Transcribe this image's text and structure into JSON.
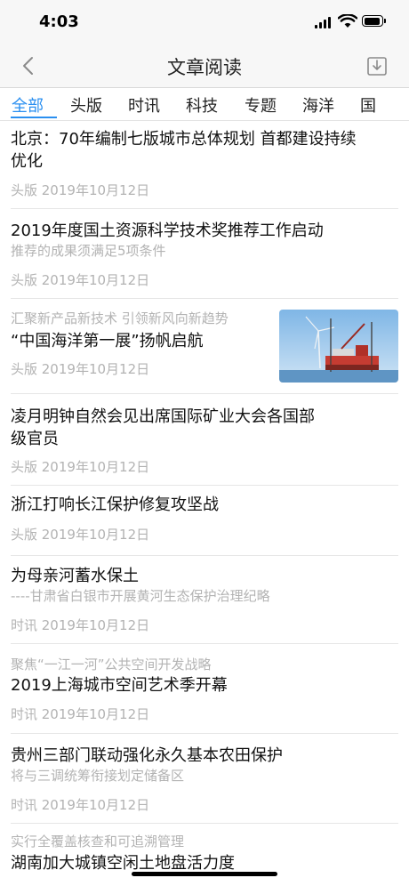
{
  "status": {
    "time": "4:03"
  },
  "nav": {
    "title": "文章阅读"
  },
  "tabs": [
    {
      "label": "全部"
    },
    {
      "label": "头版"
    },
    {
      "label": "时讯"
    },
    {
      "label": "科技"
    },
    {
      "label": "专题"
    },
    {
      "label": "海洋"
    },
    {
      "label": "国"
    }
  ],
  "articles": [
    {
      "title_line1": "北京：70年编制七版城市总体规划 首都建设持续",
      "title_line2": "优化",
      "meta": "头版 2019年10月12日"
    },
    {
      "title_line1": "2019年度国土资源科学技术奖推荐工作启动",
      "subtitle": "推荐的成果须满足5项条件",
      "meta": "头版 2019年10月12日"
    },
    {
      "pretitle": "汇聚新产品新技术 引领新风向新趋势",
      "title_line1": "“中国海洋第一展”扬帆启航",
      "meta": "头版 2019年10月12日",
      "image": "offshore-wind-platform"
    },
    {
      "title_line1": "凌月明钟自然会见出席国际矿业大会各国部",
      "title_line2": "级官员",
      "meta": "头版 2019年10月12日"
    },
    {
      "title_line1": "浙江打响长江保护修复攻坚战",
      "meta": "头版 2019年10月12日"
    },
    {
      "title_line1": "为母亲河蓄水保土",
      "subtitle": "----甘肃省白银市开展黄河生态保护治理纪略",
      "meta": "时讯 2019年10月12日"
    },
    {
      "pretitle": "聚焦“一江一河”公共空间开发战略",
      "title_line1": "2019上海城市空间艺术季开幕",
      "meta": "时讯 2019年10月12日"
    },
    {
      "title_line1": "贵州三部门联动强化永久基本农田保护",
      "subtitle": "将与三调统筹衔接划定储备区",
      "meta": "时讯 2019年10月12日"
    },
    {
      "pretitle": "实行全覆盖核查和可追溯管理",
      "title_line1": "湖南加大城镇空闲土地盘活力度"
    }
  ],
  "colors": {
    "accent": "#2a8ff0",
    "muted": "#b3b3b3",
    "separator": "#e6e6e6"
  }
}
